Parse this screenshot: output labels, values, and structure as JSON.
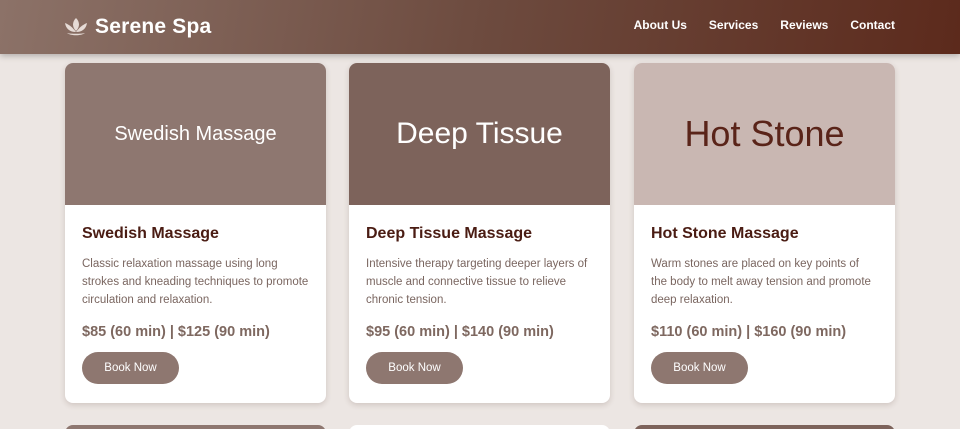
{
  "header": {
    "brand": "Serene Spa",
    "nav": [
      "About Us",
      "Services",
      "Reviews",
      "Contact"
    ]
  },
  "cards": [
    {
      "image_text": "Swedish Massage",
      "title": "Swedish Massage",
      "description": "Classic relaxation massage using long strokes and kneading techniques to promote circulation and relaxation.",
      "price": "$85 (60 min) | $125 (90 min)",
      "button": "Book Now"
    },
    {
      "image_text": "Deep Tissue",
      "title": "Deep Tissue Massage",
      "description": "Intensive therapy targeting deeper layers of muscle and connective tissue to relieve chronic tension.",
      "price": "$95 (60 min) | $140 (90 min)",
      "button": "Book Now"
    },
    {
      "image_text": "Hot Stone",
      "title": "Hot Stone Massage",
      "description": "Warm stones are placed on key points of the body to melt away tension and promote deep relaxation.",
      "price": "$110 (60 min) | $160 (90 min)",
      "button": "Book Now"
    }
  ],
  "colors": {
    "header_start": "#8c7268",
    "header_end": "#5c2a1c",
    "accent": "#8e7770",
    "title": "#4a1c13",
    "background": "#ece6e3"
  },
  "icons": {
    "logo": "lotus-icon"
  }
}
